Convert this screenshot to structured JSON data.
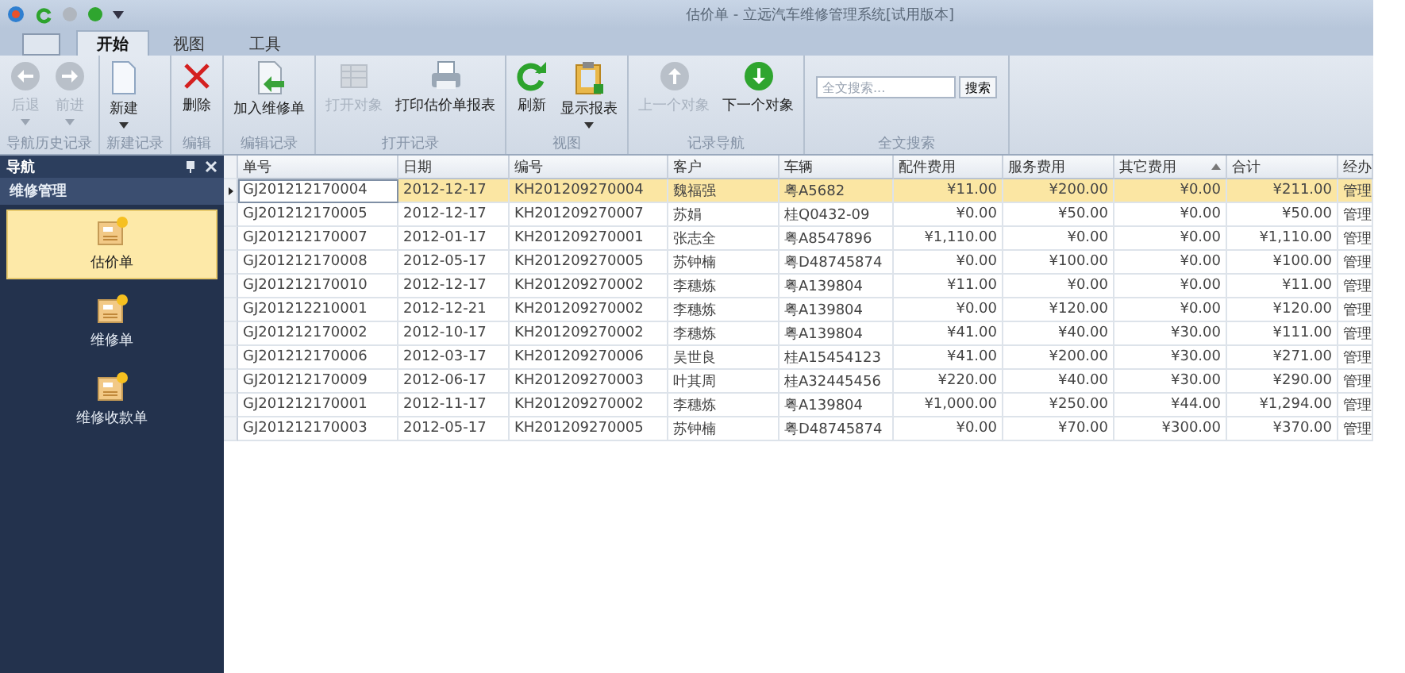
{
  "window": {
    "title": "估价单 - 立远汽车维修管理系统[试用版本]"
  },
  "tabs": [
    {
      "label": "开始",
      "selected": true
    },
    {
      "label": "视图",
      "selected": false
    },
    {
      "label": "工具",
      "selected": false
    }
  ],
  "ribbon": [
    {
      "label": "导航历史记录",
      "buttons": [
        {
          "label": "后退",
          "kind": "back",
          "disabled": true,
          "dropdown": true
        },
        {
          "label": "前进",
          "kind": "forward",
          "disabled": true,
          "dropdown": true
        }
      ]
    },
    {
      "label": "新建记录",
      "buttons": [
        {
          "label": "新建",
          "kind": "new",
          "disabled": false,
          "dropdown": true
        }
      ]
    },
    {
      "label": "编辑",
      "buttons": [
        {
          "label": "删除",
          "kind": "delete",
          "disabled": false,
          "dropdown": false
        }
      ]
    },
    {
      "label": "编辑记录",
      "buttons": [
        {
          "label": "加入维修单",
          "kind": "add",
          "disabled": false,
          "dropdown": false
        }
      ]
    },
    {
      "label": "打开记录",
      "buttons": [
        {
          "label": "打开对象",
          "kind": "open",
          "disabled": true,
          "dropdown": false
        },
        {
          "label": "打印估价单报表",
          "kind": "print",
          "disabled": false,
          "dropdown": false
        }
      ]
    },
    {
      "label": "视图",
      "buttons": [
        {
          "label": "刷新",
          "kind": "refresh",
          "disabled": false,
          "dropdown": false
        },
        {
          "label": "显示报表",
          "kind": "report",
          "disabled": false,
          "dropdown": true
        }
      ]
    },
    {
      "label": "记录导航",
      "buttons": [
        {
          "label": "上一个对象",
          "kind": "up",
          "disabled": true,
          "dropdown": false
        },
        {
          "label": "下一个对象",
          "kind": "down",
          "disabled": false,
          "dropdown": false
        }
      ]
    },
    {
      "label": "全文搜索",
      "search": {
        "placeholder": "全文搜索...",
        "button": "搜索"
      }
    }
  ],
  "navigation": {
    "title": "导航",
    "group": "维修管理",
    "items": [
      {
        "label": "估价单",
        "selected": true
      },
      {
        "label": "维修单",
        "selected": false
      },
      {
        "label": "维修收款单",
        "selected": false
      }
    ]
  },
  "table": {
    "columns": [
      {
        "label": "单号",
        "sorted": false
      },
      {
        "label": "日期",
        "sorted": false
      },
      {
        "label": "编号",
        "sorted": false
      },
      {
        "label": "客户",
        "sorted": false
      },
      {
        "label": "车辆",
        "sorted": false
      },
      {
        "label": "配件费用",
        "sorted": false
      },
      {
        "label": "服务费用",
        "sorted": false
      },
      {
        "label": "其它费用",
        "sorted": true
      },
      {
        "label": "合计",
        "sorted": false
      },
      {
        "label": "经办",
        "sorted": false
      }
    ],
    "rows": [
      {
        "selected": true,
        "cells": [
          "GJ201212170004",
          "2012-12-17",
          "KH201209270004",
          "魏福强",
          "粤A5682",
          "¥11.00",
          "¥200.00",
          "¥0.00",
          "¥211.00",
          "管理"
        ]
      },
      {
        "selected": false,
        "cells": [
          "GJ201212170005",
          "2012-12-17",
          "KH201209270007",
          "苏娟",
          "桂Q0432-09",
          "¥0.00",
          "¥50.00",
          "¥0.00",
          "¥50.00",
          "管理"
        ]
      },
      {
        "selected": false,
        "cells": [
          "GJ201212170007",
          "2012-01-17",
          "KH201209270001",
          "张志全",
          "粤A8547896",
          "¥1,110.00",
          "¥0.00",
          "¥0.00",
          "¥1,110.00",
          "管理"
        ]
      },
      {
        "selected": false,
        "cells": [
          "GJ201212170008",
          "2012-05-17",
          "KH201209270005",
          "苏钟楠",
          "粤D48745874",
          "¥0.00",
          "¥100.00",
          "¥0.00",
          "¥100.00",
          "管理"
        ]
      },
      {
        "selected": false,
        "cells": [
          "GJ201212170010",
          "2012-12-17",
          "KH201209270002",
          "李穗炼",
          "粤A139804",
          "¥11.00",
          "¥0.00",
          "¥0.00",
          "¥11.00",
          "管理"
        ]
      },
      {
        "selected": false,
        "cells": [
          "GJ201212210001",
          "2012-12-21",
          "KH201209270002",
          "李穗炼",
          "粤A139804",
          "¥0.00",
          "¥120.00",
          "¥0.00",
          "¥120.00",
          "管理"
        ]
      },
      {
        "selected": false,
        "cells": [
          "GJ201212170002",
          "2012-10-17",
          "KH201209270002",
          "李穗炼",
          "粤A139804",
          "¥41.00",
          "¥40.00",
          "¥30.00",
          "¥111.00",
          "管理"
        ]
      },
      {
        "selected": false,
        "cells": [
          "GJ201212170006",
          "2012-03-17",
          "KH201209270006",
          "吴世良",
          "桂A15454123",
          "¥41.00",
          "¥200.00",
          "¥30.00",
          "¥271.00",
          "管理"
        ]
      },
      {
        "selected": false,
        "cells": [
          "GJ201212170009",
          "2012-06-17",
          "KH201209270003",
          "叶其周",
          "桂A32445456",
          "¥220.00",
          "¥40.00",
          "¥30.00",
          "¥290.00",
          "管理"
        ]
      },
      {
        "selected": false,
        "cells": [
          "GJ201212170001",
          "2012-11-17",
          "KH201209270002",
          "李穗炼",
          "粤A139804",
          "¥1,000.00",
          "¥250.00",
          "¥44.00",
          "¥1,294.00",
          "管理"
        ]
      },
      {
        "selected": false,
        "cells": [
          "GJ201212170003",
          "2012-05-17",
          "KH201209270005",
          "苏钟楠",
          "粤D48745874",
          "¥0.00",
          "¥70.00",
          "¥300.00",
          "¥370.00",
          "管理"
        ]
      }
    ]
  }
}
